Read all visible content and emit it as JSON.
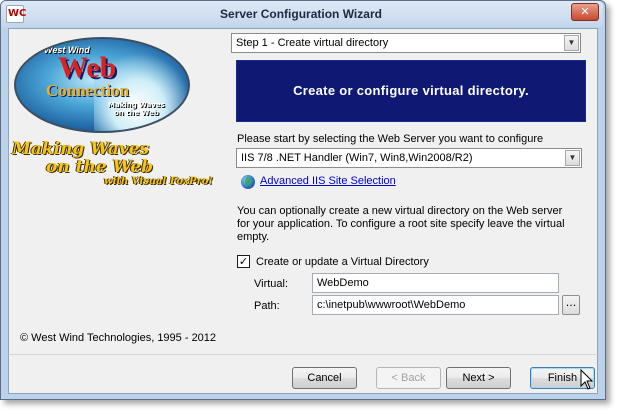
{
  "window": {
    "title": "Server Configuration Wizard",
    "close_glyph": "✕",
    "app_icon_letters": "WC"
  },
  "logo": {
    "west_wind": "West Wind",
    "web": "Web",
    "connection": "Connection",
    "tagline_line1": "Making Waves",
    "tagline_line2": "on the Web"
  },
  "slogan": {
    "line1": "Making Waves",
    "line2": "on the Web",
    "line3": "with Visual FoxPro!"
  },
  "copyright": "© West Wind Technologies, 1995 - 2012",
  "step_select": {
    "value": "Step 1 - Create virtual directory"
  },
  "banner": "Create or configure virtual directory.",
  "server_prompt": "Please start by selecting  the Web Server you want to configure",
  "server_select": {
    "value": "IIS 7/8 .NET Handler (Win7, Win8,Win2008/R2)"
  },
  "advanced_link": "Advanced  IIS Site Selection",
  "description": "You can optionally create a new virtual directory on the Web server for your application. To configure a root site specify  leave the virtual empty.",
  "create_checkbox": {
    "label": "Create or update a Virtual Directory",
    "checked": true,
    "mark": "✓"
  },
  "virtual": {
    "label": "Virtual:",
    "value": "WebDemo"
  },
  "path": {
    "label": "Path:",
    "value": "c:\\inetpub\\wwwroot\\WebDemo",
    "browse_label": "..."
  },
  "buttons": {
    "cancel": "Cancel",
    "back": "< Back",
    "next": "Next >",
    "finish": "Finish"
  },
  "colors": {
    "banner_bg": "#0f1973",
    "link": "#0000cc",
    "slogan": "#f6c51a"
  }
}
